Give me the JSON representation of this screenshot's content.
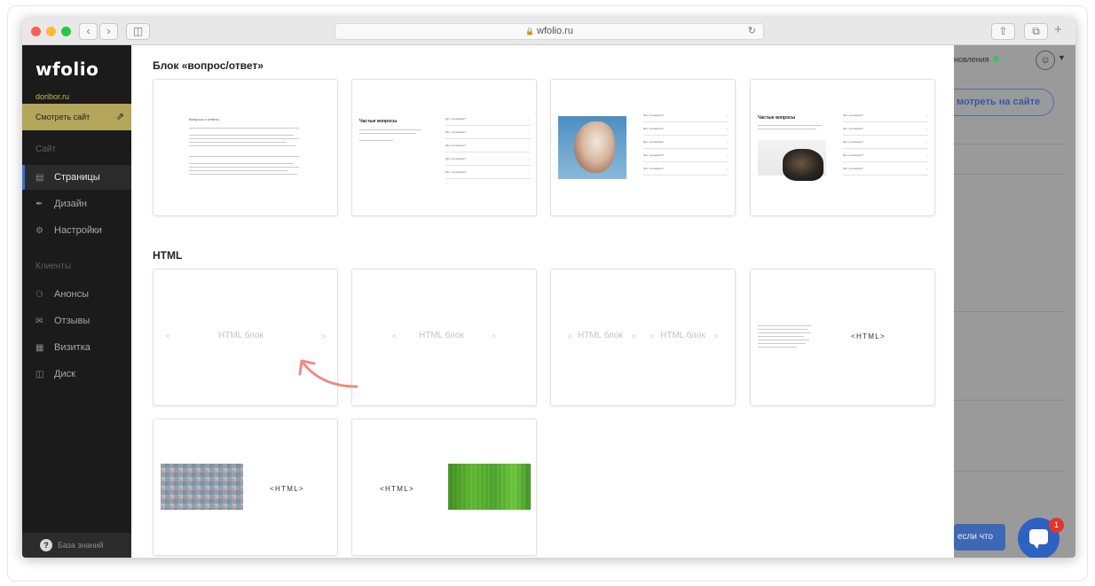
{
  "browser": {
    "url": "wfolio.ru"
  },
  "sidebar": {
    "logo": "wfolio",
    "domain": "doribor.ru",
    "view_site": "Смотреть сайт",
    "section_site": "Сайт",
    "section_clients": "Клиенты",
    "items": [
      {
        "label": "Страницы",
        "icon": "page-icon"
      },
      {
        "label": "Дизайн",
        "icon": "brush-icon"
      },
      {
        "label": "Настройки",
        "icon": "gear-icon"
      },
      {
        "label": "Анонсы",
        "icon": "megaphone-icon"
      },
      {
        "label": "Отзывы",
        "icon": "chat-bubbles-icon"
      },
      {
        "label": "Визитка",
        "icon": "card-icon"
      },
      {
        "label": "Диск",
        "icon": "database-icon"
      }
    ],
    "knowledge_base": "База знаний"
  },
  "panel": {
    "section_faq": "Блок «вопрос/ответ»",
    "section_html": "HTML",
    "faq_title": "Частые вопросы",
    "faq_small_title": "Вопросы и ответы",
    "faq_question": "Это что вопрос?",
    "html_block": "HTML блок",
    "html_tag": "<HTML>",
    "arrow_left": "<",
    "arrow_right": ">"
  },
  "backdrop": {
    "status": "новления",
    "view_site_button": "мотреть на сайте",
    "help_button": "если что",
    "chat_badge": "1"
  },
  "colors": {
    "sidebar_bg": "#1b1b1b",
    "accent_gold": "#b3a65a",
    "active_border": "#3a6fd1",
    "chat_blue": "#2e62c2",
    "pointer_red": "#f08a7f"
  }
}
